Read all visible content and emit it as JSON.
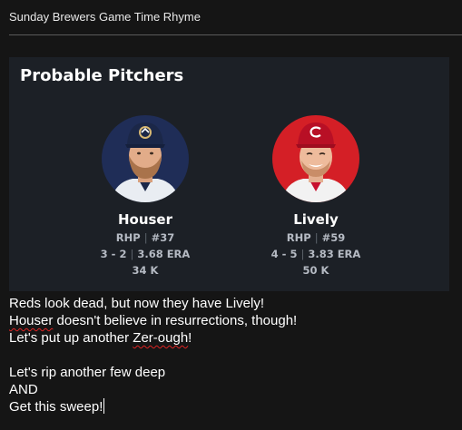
{
  "email": {
    "subject": "Sunday Brewers Game Time Rhyme"
  },
  "card": {
    "title": "Probable Pitchers",
    "pitchers": [
      {
        "name": "Houser",
        "hand": "RHP",
        "number": "#37",
        "record": "3 - 2",
        "era": "3.68 ERA",
        "strikeouts": "34 K",
        "team_color": "#1f2d57",
        "cap_color": "#1b2748",
        "cap_logo_icon": "brewers-logo-icon"
      },
      {
        "name": "Lively",
        "hand": "RHP",
        "number": "#59",
        "record": "4 - 5",
        "era": "3.83 ERA",
        "strikeouts": "50 K",
        "team_color": "#d41f26",
        "cap_color": "#c8102e",
        "cap_logo_icon": "reds-logo-icon"
      }
    ]
  },
  "message": {
    "lines": [
      "Reds look dead, but now they have Lively!",
      "Houser doesn't believe in resurrections, though!",
      "Let's put up another Zer-ough!",
      "",
      "Let's rip another few deep",
      "AND",
      "Get this sweep!"
    ],
    "line2_prefix": "",
    "line2_flagged": "Houser",
    "line2_rest": " doesn't believe in resurrections, though!",
    "line3_prefix": "Let's put up another ",
    "line3_flagged": "Zer-ough",
    "line3_rest": "!"
  }
}
